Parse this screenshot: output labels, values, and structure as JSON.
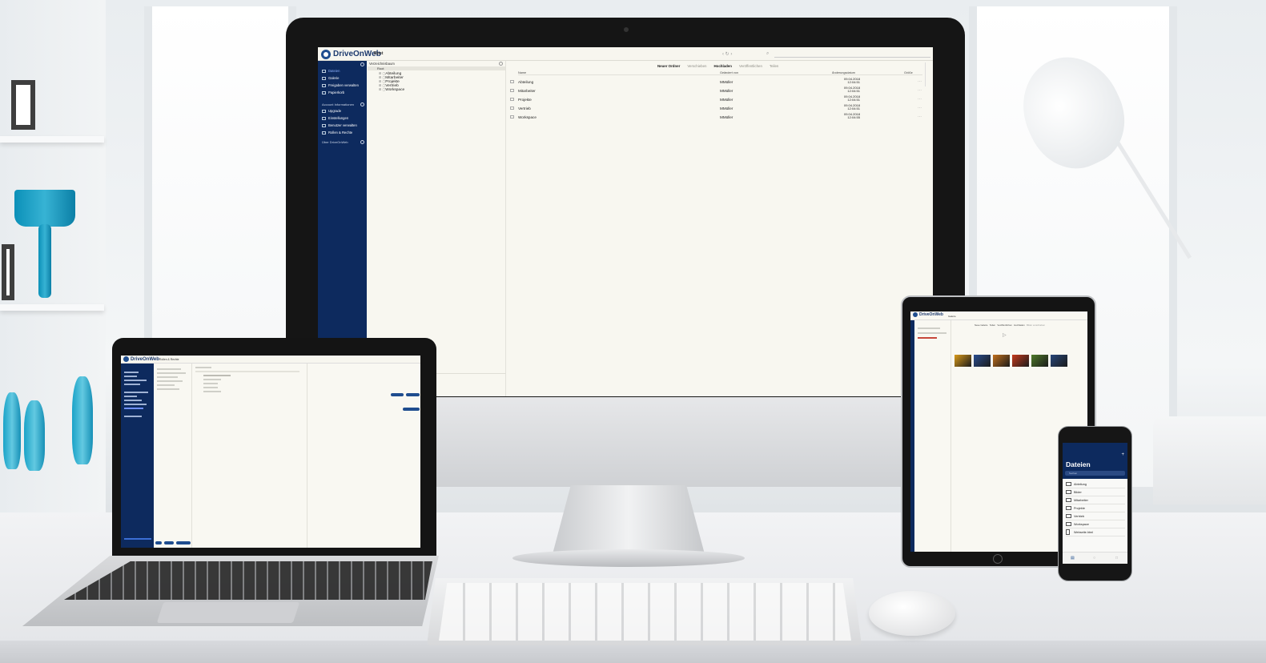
{
  "desktop": {
    "logo_text": "DriveOnWeb",
    "breadcrumb": "Root",
    "sidebar": {
      "items": [
        {
          "label": "Dateien",
          "icon": "folder-icon"
        },
        {
          "label": "Galerie",
          "icon": "image-icon"
        },
        {
          "label": "Freigaben verwalten",
          "icon": "share-icon"
        },
        {
          "label": "Papierkorb",
          "icon": "trash-icon"
        }
      ],
      "account_section": "Account Informationen",
      "account_items": [
        {
          "label": "Upgrade",
          "icon": "upgrade-icon"
        },
        {
          "label": "Einstellungen",
          "icon": "gear-icon"
        },
        {
          "label": "Benutzer verwalten",
          "icon": "users-icon"
        },
        {
          "label": "Rollen & Rechte",
          "icon": "roles-icon"
        }
      ],
      "about": "Über DriveOnWeb"
    },
    "tree": {
      "header": "Verzeichnisbaum",
      "root": "Root",
      "items": [
        "Abteilung",
        "Mitarbeiter",
        "Projekte",
        "Vertrieb",
        "Workspace"
      ]
    },
    "toolbar_tabs": [
      {
        "label": "Neuer Ordner",
        "bold": true
      },
      {
        "label": "Verschieben",
        "bold": false
      },
      {
        "label": "Hochladen",
        "bold": true
      },
      {
        "label": "Veröffentlichen",
        "bold": false
      },
      {
        "label": "Teilen",
        "bold": false
      }
    ],
    "table": {
      "headers": {
        "name": "Name",
        "edited_by": "Geändert von",
        "date": "Änderungsdatum",
        "size": "Größe"
      },
      "rows": [
        {
          "name": "Abteilung",
          "edited_by": "MMüller",
          "date": "09.04.2018",
          "time": "12:04:51"
        },
        {
          "name": "Mitarbeiter",
          "edited_by": "MMüller",
          "date": "09.04.2018",
          "time": "12:04:51"
        },
        {
          "name": "Projekte",
          "edited_by": "MMüller",
          "date": "09.04.2018",
          "time": "12:04:51"
        },
        {
          "name": "Vertrieb",
          "edited_by": "MMüller",
          "date": "09.04.2018",
          "time": "12:04:51"
        },
        {
          "name": "Workspace",
          "edited_by": "MMüller",
          "date": "09.04.2018",
          "time": "12:04:55"
        }
      ]
    }
  },
  "laptop": {
    "logo_text": "DriveOnWeb",
    "breadcrumb": "Rollen & Rechte"
  },
  "tablet": {
    "logo_text": "DriveOnWeb",
    "breadcrumb": "Galerie",
    "tabs": [
      "Neue Galerie",
      "Teilen",
      "Veröffentlichen",
      "Hochladen",
      "Bilder verschieben"
    ],
    "thumb_colors": [
      "#d99a1a",
      "#2a4d8f",
      "#c2701c",
      "#c63a1c",
      "#4f7a2a",
      "#27467a"
    ]
  },
  "phone": {
    "title": "Dateien",
    "search_placeholder": "Suchen",
    "items": [
      "Abteilung",
      "Bilder",
      "Mitarbeiter",
      "Projekte",
      "Vertrieb",
      "Workspace",
      "Webseite.html"
    ]
  },
  "colors": {
    "brand_navy": "#0d2a5e",
    "brand_blue": "#1f4d8f",
    "app_background": "#f8f7f0"
  }
}
